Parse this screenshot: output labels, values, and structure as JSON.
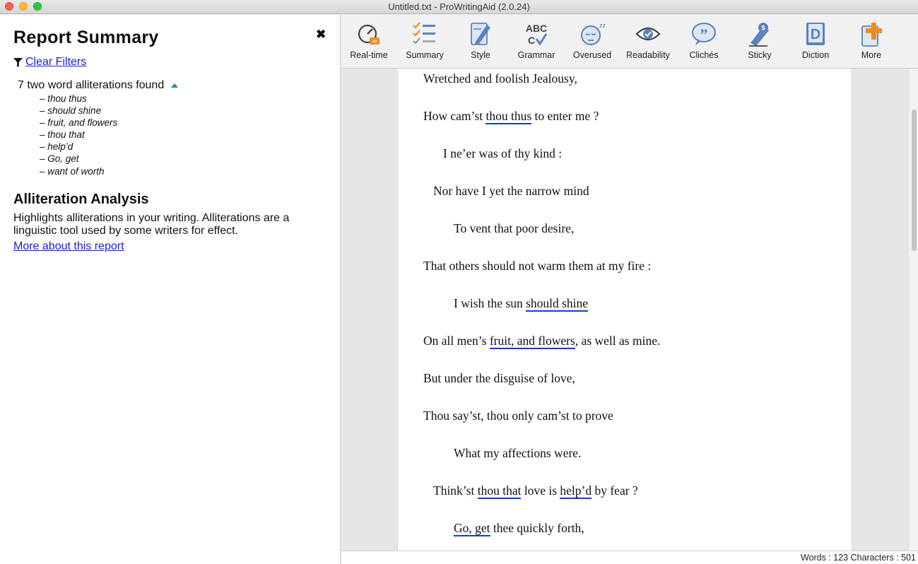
{
  "window": {
    "title": "Untitled.txt - ProWritingAid (2.0.24)"
  },
  "sidebar": {
    "title": "Report Summary",
    "close_glyph": "✖",
    "clear_filters": "Clear Filters",
    "found_text": "7 two word alliterations found",
    "alliterations": [
      "thou thus",
      "should shine",
      "fruit, and flowers",
      "thou that",
      "help’d",
      "Go, get",
      "want of worth"
    ],
    "analysis_title": "Alliteration Analysis",
    "analysis_desc": "Highlights alliterations in your writing. Alliterations are a linguistic tool used by some writers for effect.",
    "more_link": "More about this report"
  },
  "toolbar": {
    "items": [
      {
        "label": "Real-time",
        "icon": "realtime-gauge-icon"
      },
      {
        "label": "Summary",
        "icon": "summary-checklist-icon"
      },
      {
        "label": "Style",
        "icon": "style-pen-icon"
      },
      {
        "label": "Grammar",
        "icon": "grammar-abc-icon"
      },
      {
        "label": "Overused",
        "icon": "overused-sleepy-face-icon"
      },
      {
        "label": "Readability",
        "icon": "readability-eye-icon"
      },
      {
        "label": "Clichés",
        "icon": "cliches-quote-bubble-icon"
      },
      {
        "label": "Sticky",
        "icon": "sticky-pen-icon"
      },
      {
        "label": "Diction",
        "icon": "diction-d-icon"
      },
      {
        "label": "More",
        "icon": "more-plus-icon"
      }
    ],
    "accent_blue": "#5b82b9",
    "accent_orange": "#f08a24"
  },
  "document": {
    "lines": [
      {
        "pre": "Wretched and foolish Jealousy,",
        "hl": "",
        "post": ""
      },
      {
        "pre": "How cam’st ",
        "hl": "thou thus",
        "post": " to enter me ?"
      },
      {
        "pre": "I ne’er was of thy kind :",
        "hl": "",
        "post": ""
      },
      {
        "pre": "Nor have I yet the narrow mind",
        "hl": "",
        "post": ""
      },
      {
        "pre": "To vent that poor desire,",
        "hl": "",
        "post": ""
      },
      {
        "pre": "That others should not warm them at my fire :",
        "hl": "",
        "post": ""
      },
      {
        "pre": "I wish the sun ",
        "hl": "should shine",
        "post": ""
      },
      {
        "pre": "On all men’s ",
        "hl": "fruit, and flowers",
        "post": ", as well as mine."
      },
      {
        "pre": "But under the disguise of love,",
        "hl": "",
        "post": ""
      },
      {
        "pre": "Thou say’st, thou only cam’st to prove",
        "hl": "",
        "post": ""
      },
      {
        "pre": "What my affections were.",
        "hl": "",
        "post": ""
      },
      {
        "pre": "Think’st ",
        "hl": "thou that",
        "post": " love is ",
        "hl2": "help’d",
        "post2": " by fear ?"
      },
      {
        "pre": "",
        "hl": "Go, get",
        "post": " thee quickly forth,"
      }
    ],
    "highlight_color": "#1a3cc2"
  },
  "status": {
    "text": "Words : 123 Characters : 501"
  }
}
